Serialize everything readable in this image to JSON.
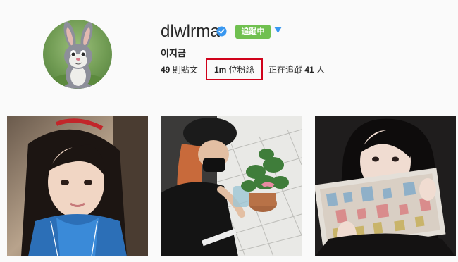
{
  "profile": {
    "username": "dlwlrma",
    "full_name": "이지금",
    "follow_button_label": "追蹤中",
    "verified_icon": "verified-badge-icon",
    "dropdown_icon": "triangle-down-icon"
  },
  "stats": {
    "posts_count": "49",
    "posts_label": " 則貼文",
    "followers_count": "1m",
    "followers_label": " 位粉絲",
    "following_prefix": "正在追蹤 ",
    "following_count": "41",
    "following_suffix": " 人"
  },
  "colors": {
    "follow_button": "#70c050",
    "verified": "#3897f0",
    "highlight_box": "#d0021b"
  }
}
